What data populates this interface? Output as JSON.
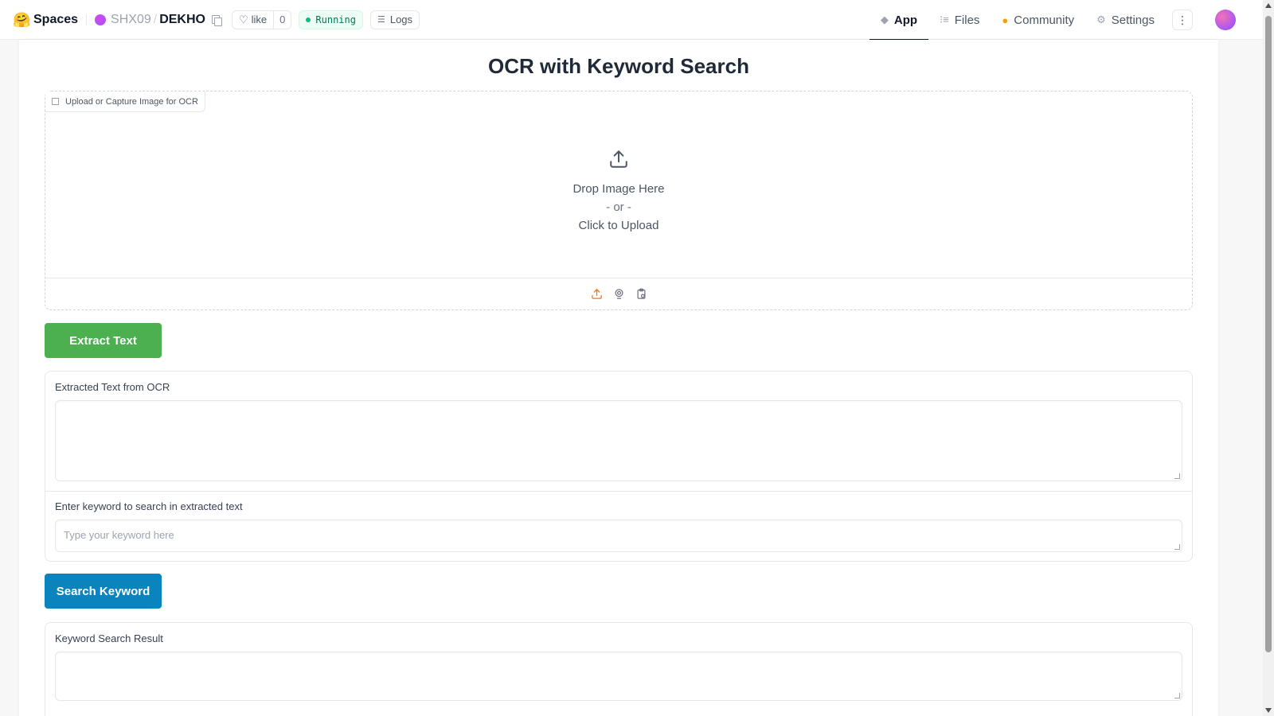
{
  "topbar": {
    "brand": "Spaces",
    "owner": "SHX09",
    "repo": "DEKHO",
    "like_label": "like",
    "like_count": "0",
    "status": "Running",
    "logs_label": "Logs",
    "tabs": [
      {
        "label": "App",
        "icon": "cube-icon",
        "active": true
      },
      {
        "label": "Files",
        "icon": "files-icon",
        "active": false
      },
      {
        "label": "Community",
        "icon": "community-icon",
        "active": false
      },
      {
        "label": "Settings",
        "icon": "gear-icon",
        "active": false
      }
    ]
  },
  "main": {
    "title": "OCR with Keyword Search",
    "upload": {
      "label": "Upload or Capture Image for OCR",
      "drop_text": "Drop Image Here",
      "or_text": "- or -",
      "click_text": "Click to Upload"
    },
    "extract_button": "Extract Text",
    "extracted_label": "Extracted Text from OCR",
    "extracted_value": "",
    "keyword_label": "Enter keyword to search in extracted text",
    "keyword_placeholder": "Type your keyword here",
    "search_button": "Search Keyword",
    "result_label": "Keyword Search Result",
    "result_value": ""
  },
  "colors": {
    "extract_button": "#4caf50",
    "search_button": "#0b84bd",
    "running_status": "#10b981",
    "upload_icon_active": "#f97316"
  }
}
